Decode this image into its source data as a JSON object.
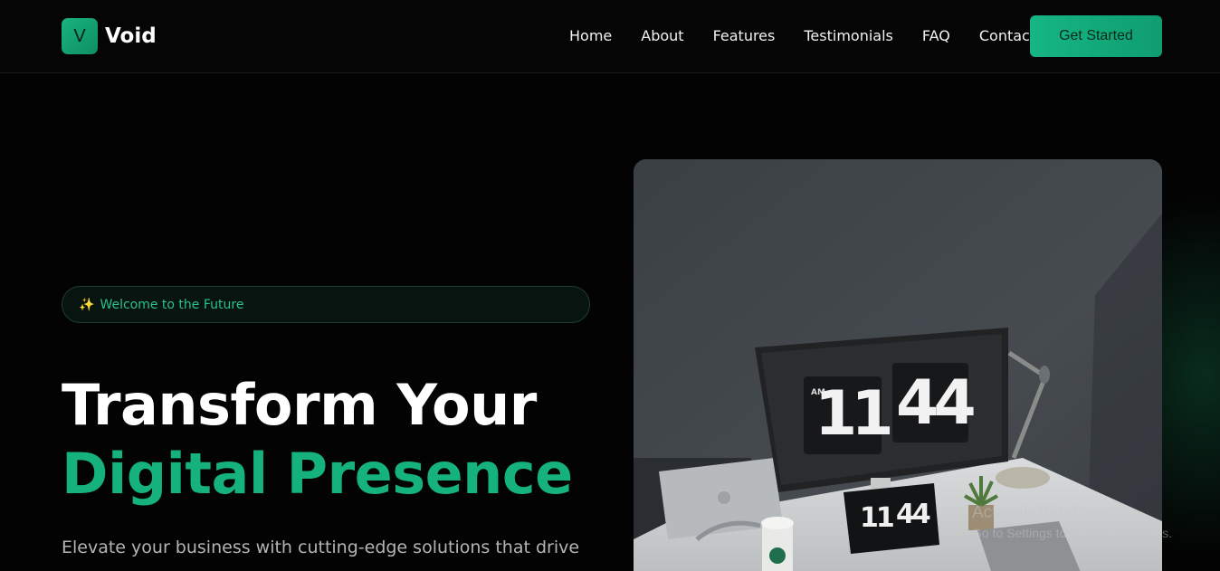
{
  "brand": {
    "logo_letter": "V",
    "name": "Void",
    "accent": "#16b27d"
  },
  "nav": {
    "links": [
      "Home",
      "About",
      "Features",
      "Testimonials",
      "FAQ",
      "Contact"
    ],
    "cta_label": "Get Started"
  },
  "hero": {
    "badge_icon": "✨",
    "badge_text": "Welcome to the Future",
    "title_line1": "Transform Your",
    "title_line2": "Digital Presence",
    "subtitle": "Elevate your business with cutting-edge solutions that drive",
    "image": {
      "monitor_clock": {
        "period": "AM",
        "hours": "11",
        "minutes": "44"
      },
      "tablet_clock": {
        "hours": "11",
        "minutes": "44"
      }
    }
  },
  "os_watermark": {
    "title": "Activate Windows",
    "subtitle": "Go to Settings to activate Windows."
  }
}
